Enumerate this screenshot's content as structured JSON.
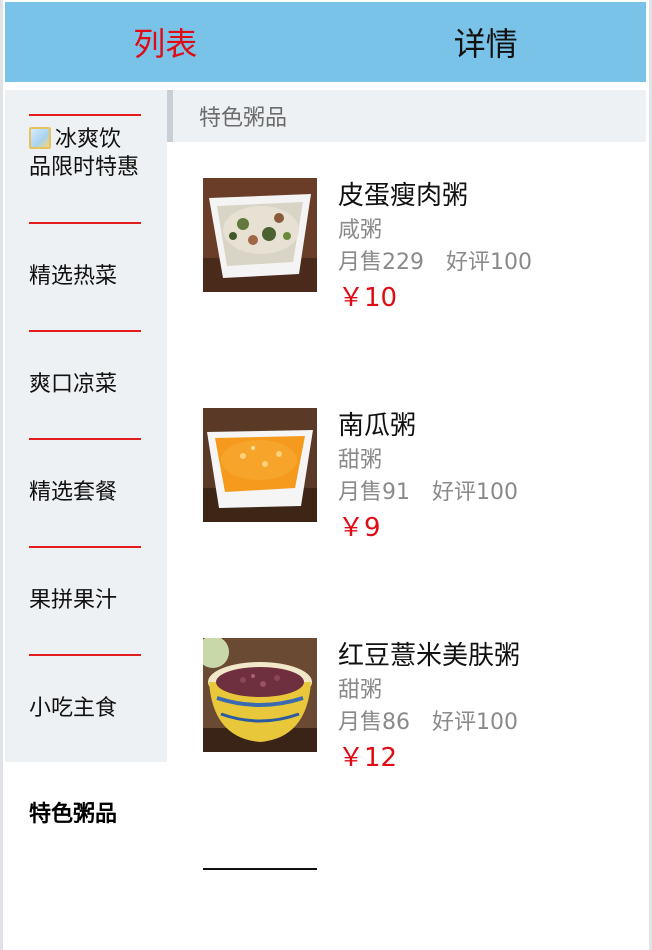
{
  "header": {
    "tabs": [
      {
        "label": "列表",
        "active": true
      },
      {
        "label": "详情",
        "active": false
      }
    ],
    "background": "#79c3e8",
    "active_color": "#e00b14"
  },
  "menu": {
    "items": [
      {
        "label": "冰爽饮品限时特惠",
        "icon": "hot-promo-icon"
      },
      {
        "label": "精选热菜"
      },
      {
        "label": "爽口凉菜"
      },
      {
        "label": "精选套餐"
      },
      {
        "label": "果拼果汁"
      },
      {
        "label": "小吃主食"
      },
      {
        "label": "特色粥品",
        "active": true
      }
    ],
    "divider_color": "#e21b1b"
  },
  "section": {
    "title": "特色粥品"
  },
  "products": [
    {
      "name": "皮蛋瘦肉粥",
      "type": "咸粥",
      "sales": "月售229",
      "rating": "好评100",
      "price": "￥10",
      "image": "century-egg-porridge-photo"
    },
    {
      "name": "南瓜粥",
      "type": "甜粥",
      "sales": "月售91",
      "rating": "好评100",
      "price": "￥9",
      "image": "pumpkin-porridge-photo"
    },
    {
      "name": "红豆薏米美肤粥",
      "type": "甜粥",
      "sales": "月售86",
      "rating": "好评100",
      "price": "￥12",
      "image": "red-bean-porridge-photo"
    }
  ]
}
